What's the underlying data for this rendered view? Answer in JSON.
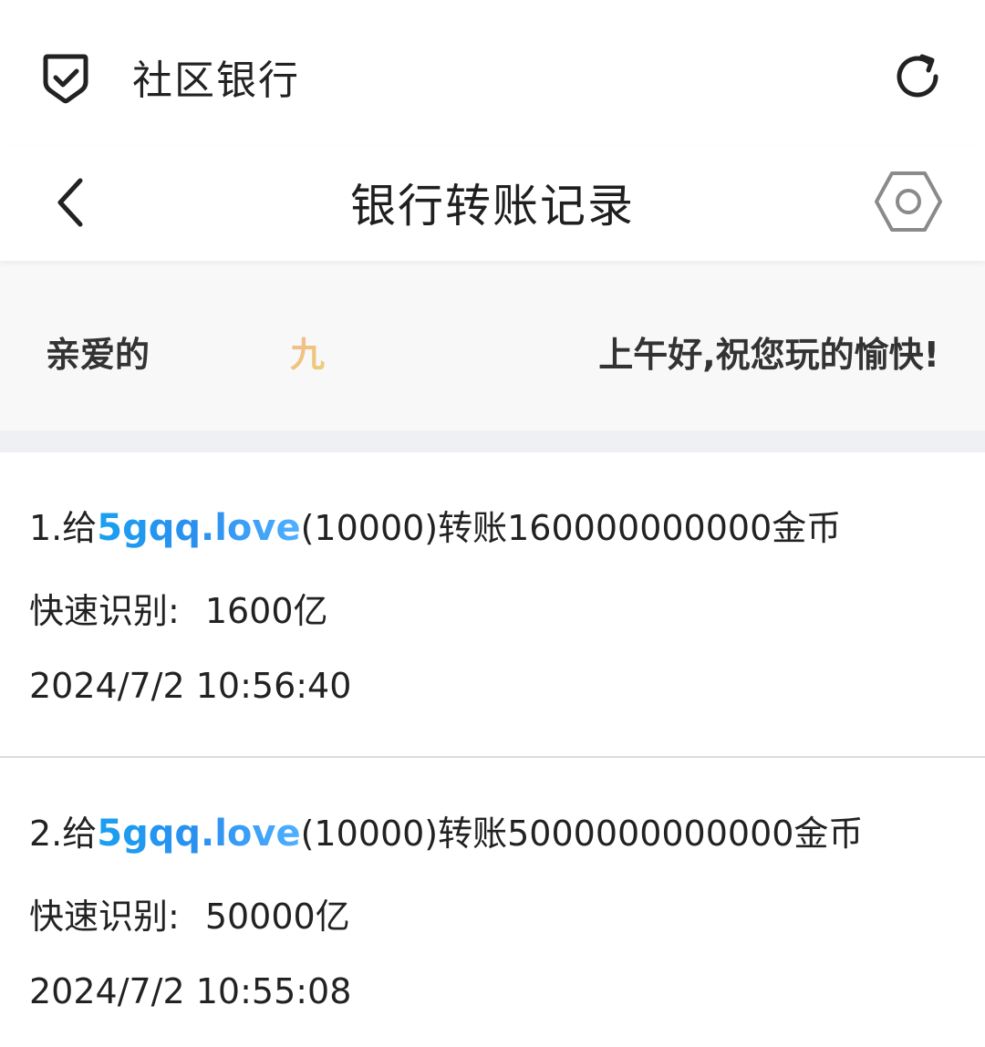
{
  "appbar": {
    "title": "社区银行",
    "left_icon": "shield-check-icon",
    "right_icon": "refresh-icon"
  },
  "navbar": {
    "title": "银行转账记录",
    "back_icon": "chevron-left-icon",
    "settings_icon": "hexagon-settings-icon"
  },
  "greeting": {
    "prefix": "亲爱的",
    "name": "九",
    "message": "上午好,祝您玩的愉快!"
  },
  "colors": {
    "link_blue": "#2b8ff0",
    "name_gradient_start": "#f2b8a0",
    "name_gradient_end": "#e8d07a",
    "gap_bar": "#eef0f3"
  },
  "records": [
    {
      "index_prefix": "1.给",
      "site": "5gqq.love",
      "transfer_text": "(10000)转账160000000000金币",
      "quick_label": "快速识别:",
      "quick_value": "1600亿",
      "timestamp": "2024/7/2 10:56:40"
    },
    {
      "index_prefix": "2.给",
      "site": "5gqq.love",
      "transfer_text": "(10000)转账5000000000000金币",
      "quick_label": "快速识别:",
      "quick_value": "50000亿",
      "timestamp": "2024/7/2 10:55:08"
    }
  ]
}
